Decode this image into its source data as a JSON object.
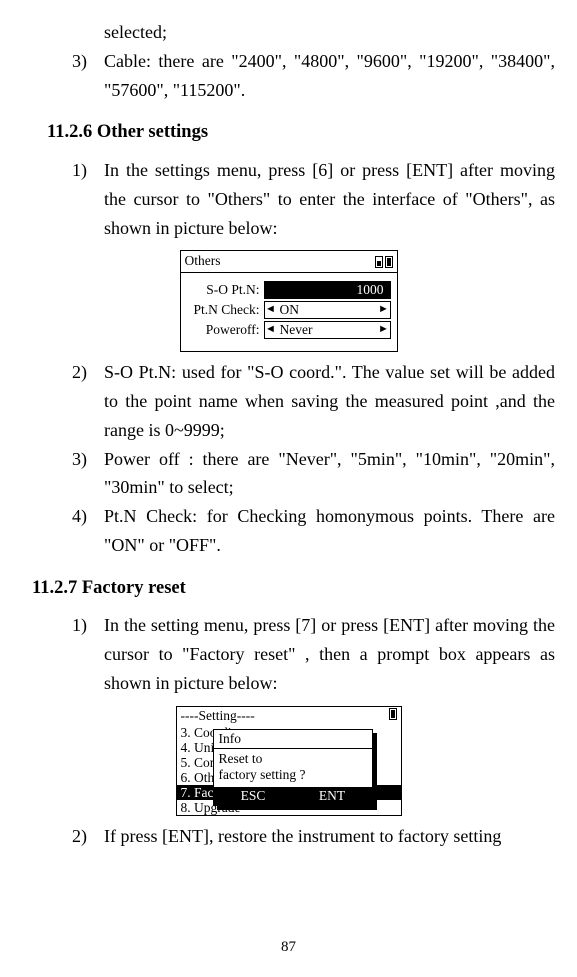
{
  "intro_tail": "selected;",
  "li3_cable": "Cable: there are \"2400\", \"4800\", \"9600\", \"19200\", \"38400\", \"57600\", \"115200\".",
  "h_other": "11.2.6 Other settings",
  "other": {
    "li1": "In the settings menu, press [6] or press [ENT] after moving the cursor to \"Others\" to enter the interface of \"Others\", as shown in picture below:",
    "fig": {
      "title": "Others",
      "r1_label": "S-O Pt.N:",
      "r1_value": "1000",
      "r2_label": "Pt.N Check:",
      "r2_value": "ON",
      "r3_label": "Poweroff:",
      "r3_value": "Never"
    },
    "li2": "S-O Pt.N: used for \"S-O coord.\". The value set will be added to the point name when saving the measured point ,and the range is 0~9999;",
    "li3": "Power off : there are \"Never\", \"5min\", \"10min\", \"20min\", \"30min\" to select;",
    "li4": "Pt.N Check: for Checking homonymous points. There are \"ON\" or \"OFF\"."
  },
  "h_factory": "11.2.7 Factory reset",
  "factory": {
    "li1": "In the setting menu, press [7] or press [ENT] after moving the cursor to \"Factory reset\" , then a prompt box appears as shown in picture below:",
    "fig": {
      "title": "----Setting----",
      "m3": "3. Coordinate",
      "m4": "4. Units",
      "m5": "5. Comm.",
      "m6": "6. Others",
      "m7": "7. Factory reset",
      "m8": "8. Upgrade",
      "popup_title": "Info",
      "popup_line1": "Reset to",
      "popup_line2": "factory setting ?",
      "btn_esc": "ESC",
      "btn_ent": "ENT"
    },
    "li2": "If press [ENT], restore the instrument to factory setting"
  },
  "nums": {
    "n1": "1)",
    "n2": "2)",
    "n3": "3)",
    "n4": "4)"
  },
  "page_num": "87",
  "arrows": {
    "left": "◄",
    "right": "►"
  }
}
